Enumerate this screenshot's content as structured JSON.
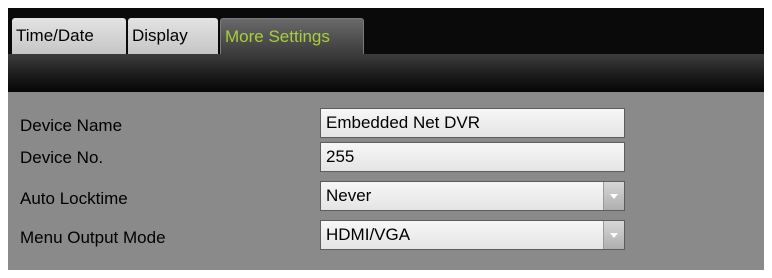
{
  "tabs": [
    {
      "label": "Time/Date",
      "active": false
    },
    {
      "label": "Display",
      "active": false
    },
    {
      "label": "More Settings",
      "active": true
    }
  ],
  "fields": {
    "device_name": {
      "label": "Device Name",
      "value": "Embedded Net DVR"
    },
    "device_no": {
      "label": "Device No.",
      "value": "255"
    },
    "auto_locktime": {
      "label": "Auto Locktime",
      "value": "Never"
    },
    "menu_output_mode": {
      "label": "Menu Output Mode",
      "value": "HDMI/VGA"
    }
  },
  "colors": {
    "active_tab_text": "#a8cf3a",
    "panel_background": "#8a8a8a",
    "header_background": "#0a0a0a"
  }
}
